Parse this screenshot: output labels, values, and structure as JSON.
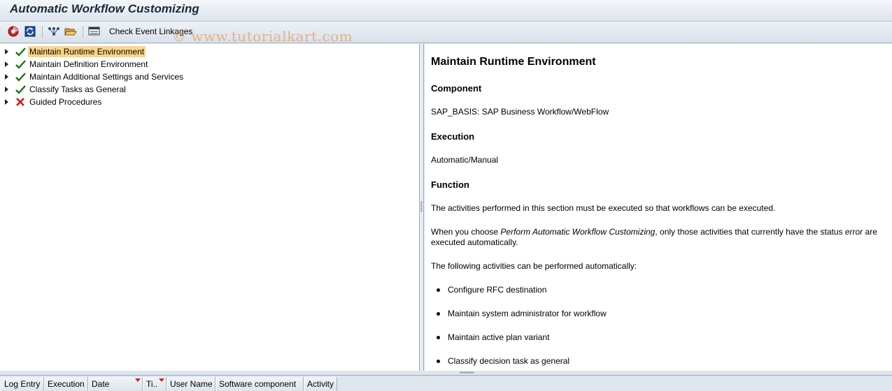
{
  "window": {
    "title": "Automatic Workflow Customizing"
  },
  "toolbar": {
    "buttons": [
      {
        "icon": "execute-icon"
      },
      {
        "icon": "refresh-icon"
      },
      {
        "icon": "structure-icon"
      },
      {
        "icon": "open-folder-icon"
      },
      {
        "icon": "event-linkage-icon"
      }
    ],
    "check_event_linkages_label": "Check Event Linkages"
  },
  "watermark": "© www.tutorialkart.com",
  "tree": {
    "items": [
      {
        "label": "Maintain Runtime Environment",
        "status": "ok",
        "selected": true
      },
      {
        "label": "Maintain Definition Environment",
        "status": "ok"
      },
      {
        "label": "Maintain Additional Settings and Services",
        "status": "ok"
      },
      {
        "label": "Classify Tasks as General",
        "status": "ok"
      },
      {
        "label": "Guided Procedures",
        "status": "error"
      }
    ]
  },
  "doc": {
    "title": "Maintain Runtime Environment",
    "component_heading": "Component",
    "component_value": "SAP_BASIS: SAP Business Workflow/WebFlow",
    "execution_heading": "Execution",
    "execution_value": "Automatic/Manual",
    "function_heading": "Function",
    "para1": "The activities performed in this section must be executed so that workflows can be executed.",
    "para2_a": "When you choose ",
    "para2_em": "Perform Automatic Workflow Customizing",
    "para2_b": ",  only those activities that currently have the status ",
    "para2_em2": "error",
    "para2_c": " are executed automatically.",
    "para3": "The following activities can be performed automatically:",
    "bullets": [
      "Configure RFC destination",
      "Maintain system administrator for workflow",
      "Maintain active plan variant",
      "Classify decision task as general"
    ]
  },
  "log_columns": [
    {
      "label": "Log Entry"
    },
    {
      "label": "Execution"
    },
    {
      "label": "Date"
    },
    {
      "label": "Ti.."
    },
    {
      "label": "User Name"
    },
    {
      "label": "Software component"
    },
    {
      "label": "Activity"
    }
  ],
  "colors": {
    "selection": "#fcd58a",
    "ok": "#1a8a1a",
    "error": "#d01818",
    "toolbar_bg": "#dfe6ee"
  }
}
